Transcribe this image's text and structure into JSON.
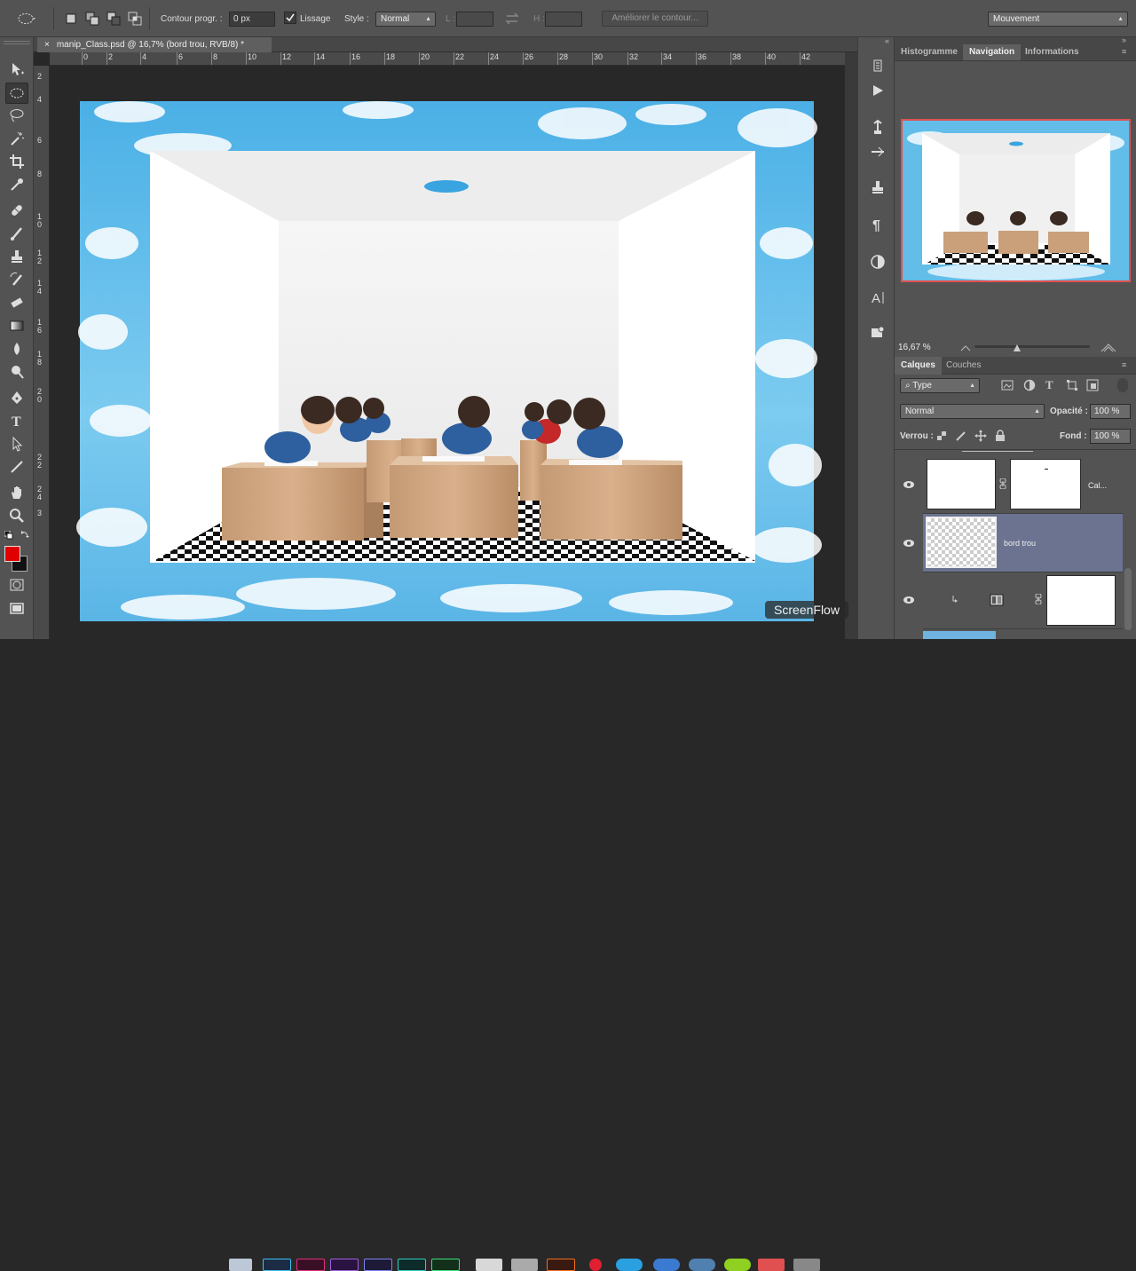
{
  "options_bar": {
    "contour_label": "Contour progr. :",
    "contour_value": "0 px",
    "lissage_label": "Lissage",
    "style_label": "Style :",
    "style_value": "Normal",
    "l_label": "L :",
    "h_label": "H :",
    "refine_button": "Améliorer le contour...",
    "workspace_value": "Mouvement"
  },
  "document": {
    "tab_title": "manip_Class.psd @ 16,7% (bord trou, RVB/8) *",
    "close_glyph": "×"
  },
  "ruler": {
    "h_ticks": [
      "0",
      "2",
      "4",
      "6",
      "8",
      "10",
      "12",
      "14",
      "16",
      "18",
      "20",
      "22",
      "24",
      "26",
      "28",
      "30",
      "32",
      "34",
      "36",
      "38",
      "40",
      "42"
    ],
    "v_ticks": [
      "2",
      "4",
      "6",
      "8",
      "1\n0",
      "1\n2",
      "1\n4",
      "1\n6",
      "1\n8",
      "2\n0",
      "2\n2",
      "2\n4",
      "3"
    ]
  },
  "right_panel": {
    "top_tabs": [
      "Histogramme",
      "Navigation",
      "Informations"
    ],
    "active_top_tab": "Navigation",
    "zoom_value": "16,67 %",
    "layer_tabs": [
      "Calques",
      "Couches"
    ],
    "active_layer_tab": "Calques",
    "filter_value": "Type",
    "blend_mode": "Normal",
    "opacity_label": "Opacité :",
    "opacity_value": "100 %",
    "lock_label": "Verrou :",
    "fill_label": "Fond :",
    "fill_value": "100 %",
    "layers": [
      {
        "name": "Cal..."
      },
      {
        "name": "bord trou"
      },
      {
        "name": ""
      }
    ]
  },
  "watermark": "ScreenFlow",
  "colors": {
    "foreground": "#e00000",
    "background": "#111111",
    "selected_layer": "#6b7391"
  }
}
